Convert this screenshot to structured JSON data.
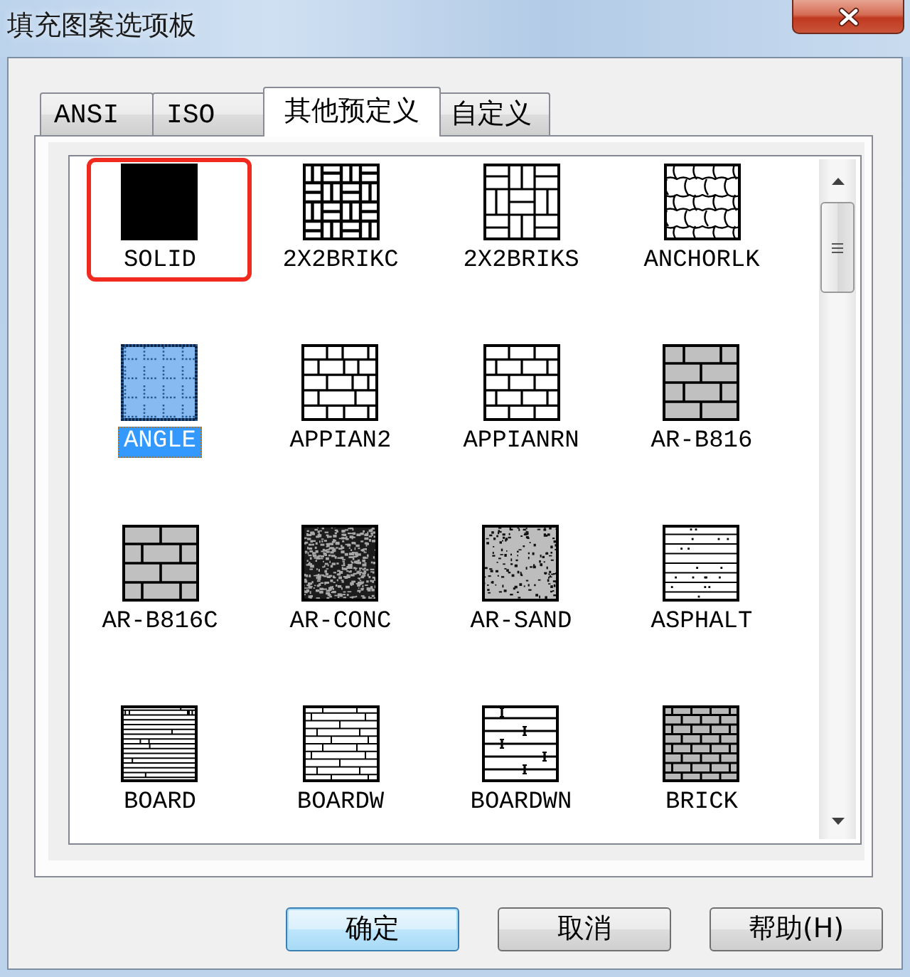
{
  "window": {
    "title": "填充图案选项板"
  },
  "tabs": [
    {
      "label": "ANSI",
      "selected": false
    },
    {
      "label": "ISO",
      "selected": false
    },
    {
      "label": "其他预定义",
      "selected": true
    },
    {
      "label": "自定义",
      "selected": false
    }
  ],
  "patterns": [
    {
      "label": "SOLID",
      "kind": "solid",
      "selected": false,
      "highlighted": true
    },
    {
      "label": "2X2BRIKC",
      "kind": "basketweave",
      "selected": false,
      "highlighted": false
    },
    {
      "label": "2X2BRIKS",
      "kind": "basketsquare",
      "selected": false,
      "highlighted": false
    },
    {
      "label": "ANCHORLK",
      "kind": "anchorlock",
      "selected": false,
      "highlighted": false
    },
    {
      "label": "ANGLE",
      "kind": "angle",
      "selected": true,
      "highlighted": false
    },
    {
      "label": "APPIAN2",
      "kind": "ashlar",
      "selected": false,
      "highlighted": false
    },
    {
      "label": "APPIANRN",
      "kind": "coursed",
      "selected": false,
      "highlighted": false
    },
    {
      "label": "AR-B816",
      "kind": "block",
      "selected": false,
      "highlighted": false
    },
    {
      "label": "AR-B816C",
      "kind": "largeblock",
      "selected": false,
      "highlighted": false
    },
    {
      "label": "AR-CONC",
      "kind": "concrete",
      "selected": false,
      "highlighted": false
    },
    {
      "label": "AR-SAND",
      "kind": "sand",
      "selected": false,
      "highlighted": false
    },
    {
      "label": "ASPHALT",
      "kind": "asphalt",
      "selected": false,
      "highlighted": false
    },
    {
      "label": "BOARD",
      "kind": "board",
      "selected": false,
      "highlighted": false
    },
    {
      "label": "BOARDW",
      "kind": "boardw",
      "selected": false,
      "highlighted": false
    },
    {
      "label": "BOARDWN",
      "kind": "boardwn",
      "selected": false,
      "highlighted": false
    },
    {
      "label": "BRICK",
      "kind": "brick",
      "selected": false,
      "highlighted": false
    }
  ],
  "buttons": [
    {
      "label": "确定",
      "focused": true
    },
    {
      "label": "取消",
      "focused": false
    },
    {
      "label": "帮助(H)",
      "focused": false
    }
  ]
}
